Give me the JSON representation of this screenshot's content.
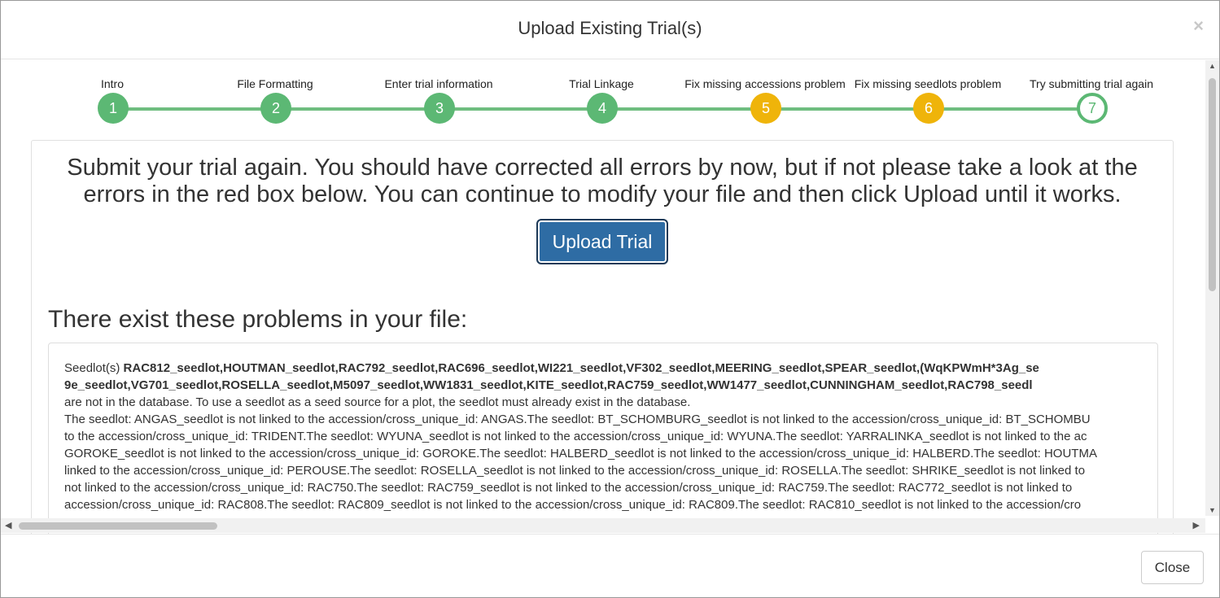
{
  "modal": {
    "title": "Upload Existing Trial(s)",
    "close_x": "×",
    "close_button": "Close"
  },
  "steps": [
    {
      "label": "Intro",
      "number": "1",
      "state": "complete"
    },
    {
      "label": "File Formatting",
      "number": "2",
      "state": "complete"
    },
    {
      "label": "Enter trial information",
      "number": "3",
      "state": "complete"
    },
    {
      "label": "Trial Linkage",
      "number": "4",
      "state": "complete"
    },
    {
      "label": "Fix missing accessions problem",
      "number": "5",
      "state": "warning"
    },
    {
      "label": "Fix missing seedlots problem",
      "number": "6",
      "state": "warning"
    },
    {
      "label": "Try submitting trial again",
      "number": "7",
      "state": "current"
    }
  ],
  "main": {
    "headline_1": "Submit your trial again. You should have corrected all errors by now, but if not please take a look at the",
    "headline_2": "errors in the red box below. You can continue to modify your file and then click Upload until it works.",
    "upload_button": "Upload Trial",
    "problems_title": "There exist these problems in your file:",
    "problems": {
      "line1_prefix": "Seedlot(s) ",
      "line1_bold": "RAC812_seedlot,HOUTMAN_seedlot,RAC792_seedlot,RAC696_seedlot,WI221_seedlot,VF302_seedlot,MEERING_seedlot,SPEAR_seedlot,(WqKPWmH*3Ag_se",
      "line2_bold": "9e_seedlot,VG701_seedlot,ROSELLA_seedlot,M5097_seedlot,WW1831_seedlot,KITE_seedlot,RAC759_seedlot,WW1477_seedlot,CUNNINGHAM_seedlot,RAC798_seedl",
      "line3": "are not in the database. To use a seedlot as a seed source for a plot, the seedlot must already exist in the database.",
      "line4": "The seedlot: ANGAS_seedlot is not linked to the accession/cross_unique_id: ANGAS.The seedlot: BT_SCHOMBURG_seedlot is not linked to the accession/cross_unique_id: BT_SCHOMBU",
      "line5": "to the accession/cross_unique_id: TRIDENT.The seedlot: WYUNA_seedlot is not linked to the accession/cross_unique_id: WYUNA.The seedlot: YARRALINKA_seedlot is not linked to the ac",
      "line6": "GOROKE_seedlot is not linked to the accession/cross_unique_id: GOROKE.The seedlot: HALBERD_seedlot is not linked to the accession/cross_unique_id: HALBERD.The seedlot: HOUTMA",
      "line7": "linked to the accession/cross_unique_id: PEROUSE.The seedlot: ROSELLA_seedlot is not linked to the accession/cross_unique_id: ROSELLA.The seedlot: SHRIKE_seedlot is not linked to",
      "line8": "not linked to the accession/cross_unique_id: RAC750.The seedlot: RAC759_seedlot is not linked to the accession/cross_unique_id: RAC759.The seedlot: RAC772_seedlot is not linked to",
      "line9": "accession/cross_unique_id: RAC808.The seedlot: RAC809_seedlot is not linked to the accession/cross_unique_id: RAC809.The seedlot: RAC810_seedlot is not linked to the accession/cro"
    }
  },
  "colors": {
    "complete": "#5cb874",
    "warning": "#efb40a",
    "primary": "#2e6ca4"
  }
}
